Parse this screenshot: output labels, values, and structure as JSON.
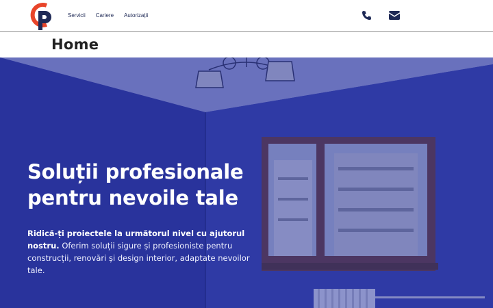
{
  "brand": {
    "logo_letters": "CP",
    "accent_orange": "#e8452a",
    "accent_navy": "#1f2a56"
  },
  "nav": {
    "items": [
      {
        "label": "Servicii"
      },
      {
        "label": "Cariere"
      },
      {
        "label": "Autorizații"
      }
    ]
  },
  "header_icons": {
    "phone": "phone-icon",
    "mail": "mail-icon"
  },
  "page": {
    "title": "Home"
  },
  "hero": {
    "heading": "Soluții profesionale pentru nevoile tale",
    "lead_bold": "Ridică-ți proiectele la următorul nivel cu ajutorul nostru.",
    "lead_rest": " Oferim soluții sigure și profesioniste pentru construcții, renovări și design interior, adaptate nevoilor tale.",
    "overlay_color": "#2934a0"
  }
}
